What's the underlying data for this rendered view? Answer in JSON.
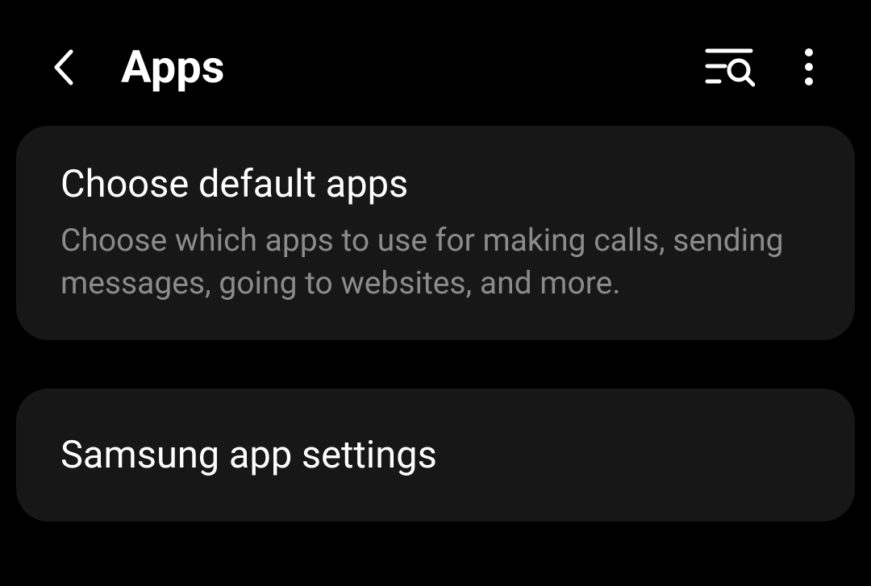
{
  "header": {
    "title": "Apps"
  },
  "cards": [
    {
      "title": "Choose default apps",
      "subtitle": "Choose which apps to use for making calls, sending messages, going to websites, and more."
    },
    {
      "title": "Samsung app settings"
    }
  ]
}
